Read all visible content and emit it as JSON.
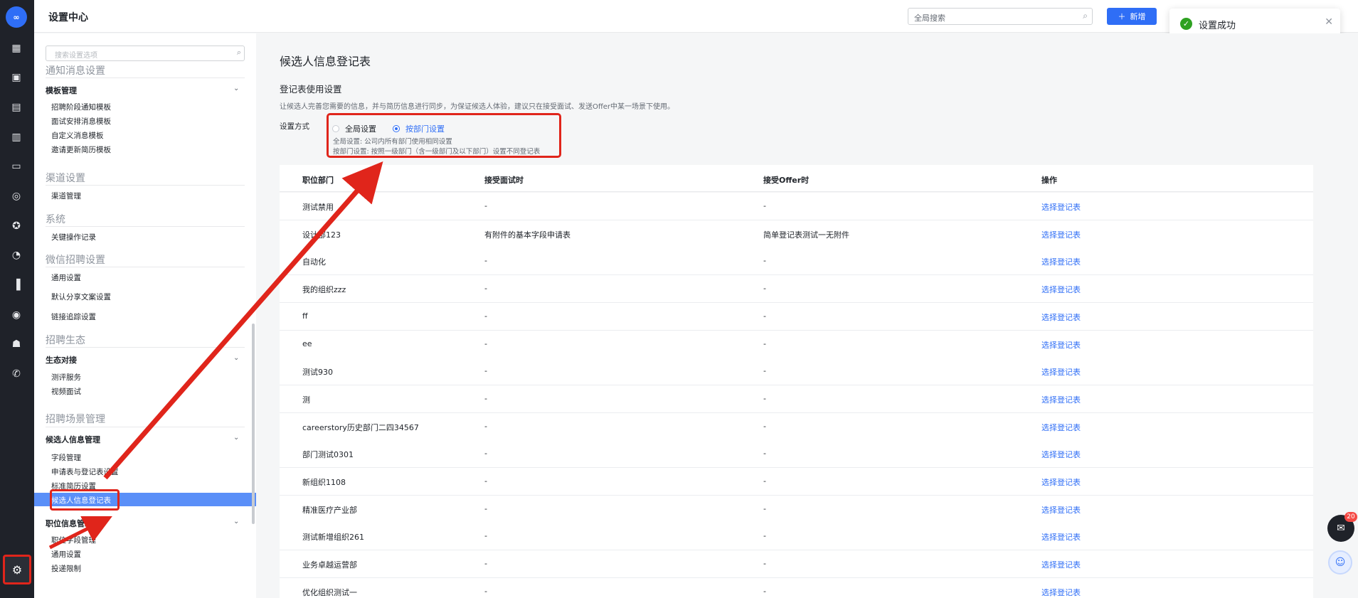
{
  "header": {
    "title": "设置中心",
    "global_search_placeholder": "全局搜索",
    "add_button": "新增"
  },
  "toast": {
    "message": "设置成功"
  },
  "sidebar": {
    "search_placeholder": "搜索设置选项",
    "sec_notify": "通知消息设置",
    "grp_template": "模板管理",
    "items_template": [
      "招聘阶段通知模板",
      "面试安排消息模板",
      "自定义消息模板",
      "邀请更新简历模板"
    ],
    "sec_channel": "渠道设置",
    "item_channel": "渠道管理",
    "sec_system": "系统",
    "item_log": "关键操作记录",
    "sec_wechat": "微信招聘设置",
    "items_wechat": [
      "通用设置",
      "默认分享文案设置",
      "链接追踪设置"
    ],
    "sec_eco": "招聘生态",
    "grp_eco": "生态对接",
    "items_eco": [
      "测评服务",
      "视频面试"
    ],
    "sec_scene": "招聘场景管理",
    "grp_candidate": "候选人信息管理",
    "items_candidate": [
      "字段管理",
      "申请表与登记表设置",
      "标准简历设置",
      "候选人信息登记表"
    ],
    "grp_position": "职位信息管理",
    "items_position": [
      "职位字段管理",
      "通用设置",
      "投递限制"
    ]
  },
  "main": {
    "title": "候选人信息登记表",
    "subtitle": "登记表使用设置",
    "description": "让候选人完善您需要的信息，并与简历信息进行同步，为保证候选人体验，建议只在接受面试、发送Offer中某一场景下使用。",
    "mode_label": "设置方式",
    "radio_global": "全局设置",
    "radio_dept": "按部门设置",
    "note_global": "全局设置: 公司内所有部门使用相同设置",
    "note_dept": "按部门设置: 按照一级部门（含一级部门及以下部门）设置不同登记表",
    "columns": [
      "职位部门",
      "接受面试时",
      "接受Offer时",
      "操作"
    ],
    "rows": [
      [
        "测试禁用",
        "-",
        "-",
        "选择登记表"
      ],
      [
        "设计部123",
        "有附件的基本字段申请表",
        "简单登记表测试一无附件",
        "选择登记表"
      ],
      [
        "自动化",
        "-",
        "-",
        "选择登记表"
      ],
      [
        "我的组织zzz",
        "-",
        "-",
        "选择登记表"
      ],
      [
        "ff",
        "-",
        "-",
        "选择登记表"
      ],
      [
        "ee",
        "-",
        "-",
        "选择登记表"
      ],
      [
        "测试930",
        "-",
        "-",
        "选择登记表"
      ],
      [
        "测",
        "-",
        "-",
        "选择登记表"
      ],
      [
        "careerstory历史部门二四34567",
        "-",
        "-",
        "选择登记表"
      ],
      [
        "部门测试0301",
        "-",
        "-",
        "选择登记表"
      ],
      [
        "新组织1108",
        "-",
        "-",
        "选择登记表"
      ],
      [
        "精准医疗产业部",
        "-",
        "-",
        "选择登记表"
      ],
      [
        "测试新增组织261",
        "-",
        "-",
        "选择登记表"
      ],
      [
        "业务卓越运营部",
        "-",
        "-",
        "选择登记表"
      ],
      [
        "优化组织测试一",
        "-",
        "-",
        "选择登记表"
      ]
    ]
  },
  "fab": {
    "badge": "20"
  },
  "colors": {
    "accent": "#2f6ef6",
    "annotation": "#e0251b",
    "success": "#2ea121"
  }
}
